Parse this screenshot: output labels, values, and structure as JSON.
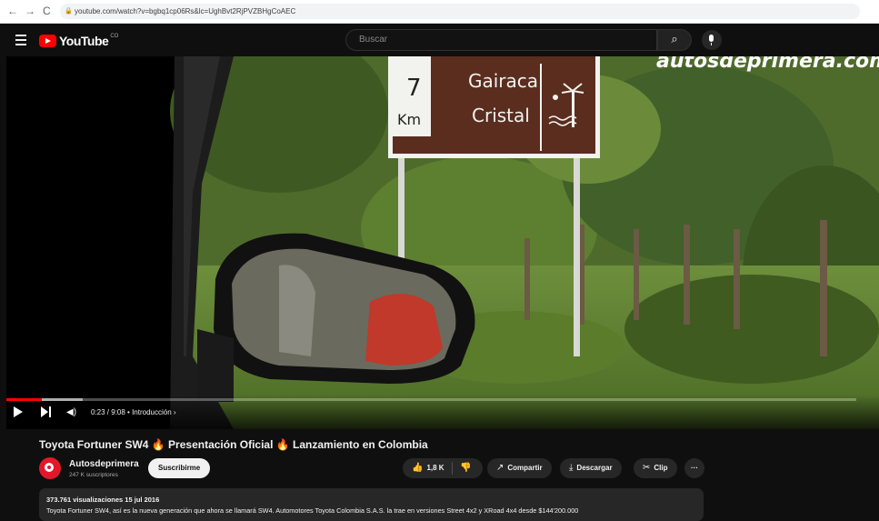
{
  "browser": {
    "back": "←",
    "forward": "→",
    "reload": "C",
    "url": "youtube.com/watch?v=bgbq1cp06Rs&lc=UghBvt2RjPVZBHgCoAEC"
  },
  "header": {
    "logo_text": "YouTube",
    "logo_country": "CO",
    "search_placeholder": "Buscar",
    "search_icon": "search-icon",
    "mic_icon": "mic-icon"
  },
  "video": {
    "watermark": "autosdeprimera.com",
    "sign_distance_number": "7",
    "sign_distance_unit": "Km",
    "sign_line1": "Gairaca",
    "sign_line2": "Cristal",
    "time_display": "0:23 / 9:08",
    "chapter": "• Introducción ›",
    "progress_fraction": 0.042,
    "buffer_fraction": 0.09
  },
  "info": {
    "title": "Toyota Fortuner SW4 🔥 Presentación Oficial 🔥 Lanzamiento en Colombia",
    "channel_name": "Autosdeprimera",
    "subscribers": "247 K suscriptores",
    "subscribe_label": "Suscribirme",
    "like_count": "1,8 K",
    "share_label": "Compartir",
    "download_label": "Descargar",
    "clip_label": "Clip",
    "more_label": "···",
    "stats": "373.761 visualizaciones  15 jul 2016",
    "description": "Toyota Fortuner SW4, así es la nueva generación que ahora se llamará SW4. Automotores Toyota Colombia S.A.S. la trae en versiones Street 4x2 y XRoad 4x4 desde $144'200.000"
  },
  "colors": {
    "brand_red": "#ff0000",
    "background": "#0f0f0f",
    "sign_brown": "#5a2d1f"
  }
}
